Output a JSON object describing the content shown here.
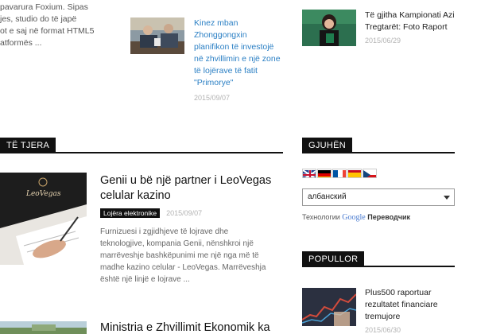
{
  "top": {
    "left_snippet": [
      "pavarura Foxium. Sipas",
      "jes, studio do të japë",
      "ot e saj në format HTML5",
      "atformës ..."
    ],
    "middle_article": {
      "title_lines": [
        "Kinez mban",
        "Zhonggongxin",
        "planifikon të investojë",
        "në zhvillimin e një zone",
        "të lojërave të fatit",
        "\"Primorye\""
      ],
      "date": "2015/09/07"
    },
    "right_article": {
      "title_lines": [
        "Të gjitha Kampionati Azi",
        "Tregtarët: Foto Raport"
      ],
      "date": "2015/06/29"
    }
  },
  "sections": {
    "others_label": "TË TJERA",
    "languages_label": "GJUHËN",
    "popular_label": "POPULLOR"
  },
  "main_article": {
    "title_lines": [
      "Genii u bë një partner i LeoVegas",
      "celular kazino"
    ],
    "category": "Lojëra elektronike",
    "date": "2015/09/07",
    "excerpt_lines": [
      "Furnizuesi i zgjidhjeve të lojrave dhe",
      "teknologjive, kompania Genii, nënshkroi një",
      "marrëveshje bashkëpunimi me një nga më të",
      "madhe kazino celular - LeoVegas. Marrëveshja",
      "është një linjë e lojrave ..."
    ],
    "image_brand": "LeoVegas"
  },
  "second_article": {
    "title": "Ministria e Zhvillimit Ekonomik ka"
  },
  "languages": {
    "flags": [
      "english-flag",
      "german-flag",
      "french-flag",
      "spanish-flag",
      "czech-flag"
    ],
    "selected_language": "албанский",
    "translator_prefix": "Технологии",
    "google_word": "Google",
    "translator_suffix": "Переводчик"
  },
  "popular": {
    "items": [
      {
        "title_lines": [
          "Plus500 raportuar",
          "rezultatet financiare",
          "tremujore"
        ],
        "date": "2015/06/30"
      }
    ]
  },
  "colors": {
    "link_blue": "#2a7fc4",
    "header_black": "#111111",
    "date_gray": "#b3b3b3"
  }
}
